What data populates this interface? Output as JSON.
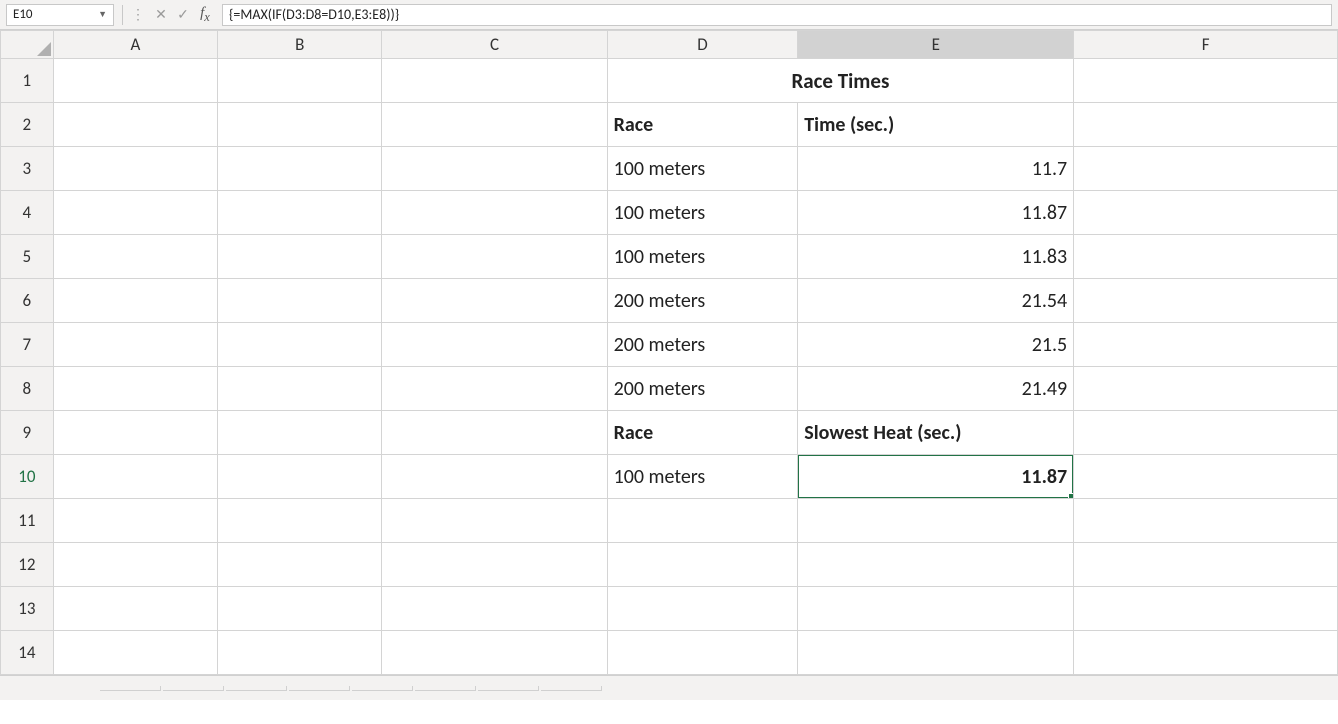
{
  "name_box": "E10",
  "formula": "{=MAX(IF(D3:D8=D10,E3:E8))}",
  "columns": [
    "A",
    "B",
    "C",
    "D",
    "E",
    "F"
  ],
  "row_count": 14,
  "selected_cell": {
    "row": 10,
    "col": "E"
  },
  "cells": {
    "title": "Race Times",
    "D2": "Race",
    "E2": "Time (sec.)",
    "D3": "100 meters",
    "E3": "11.7",
    "D4": "100 meters",
    "E4": "11.87",
    "D5": "100 meters",
    "E5": "11.83",
    "D6": "200 meters",
    "E6": "21.54",
    "D7": "200 meters",
    "E7": "21.5",
    "D8": "200 meters",
    "E8": "21.49",
    "D9": "Race",
    "E9": "Slowest Heat (sec.)",
    "D10": "100 meters",
    "E10": "11.87"
  },
  "col_widths": {
    "rowhead": 52,
    "A": 162,
    "B": 162,
    "C": 222,
    "D": 188,
    "E": 272,
    "F": 260
  }
}
